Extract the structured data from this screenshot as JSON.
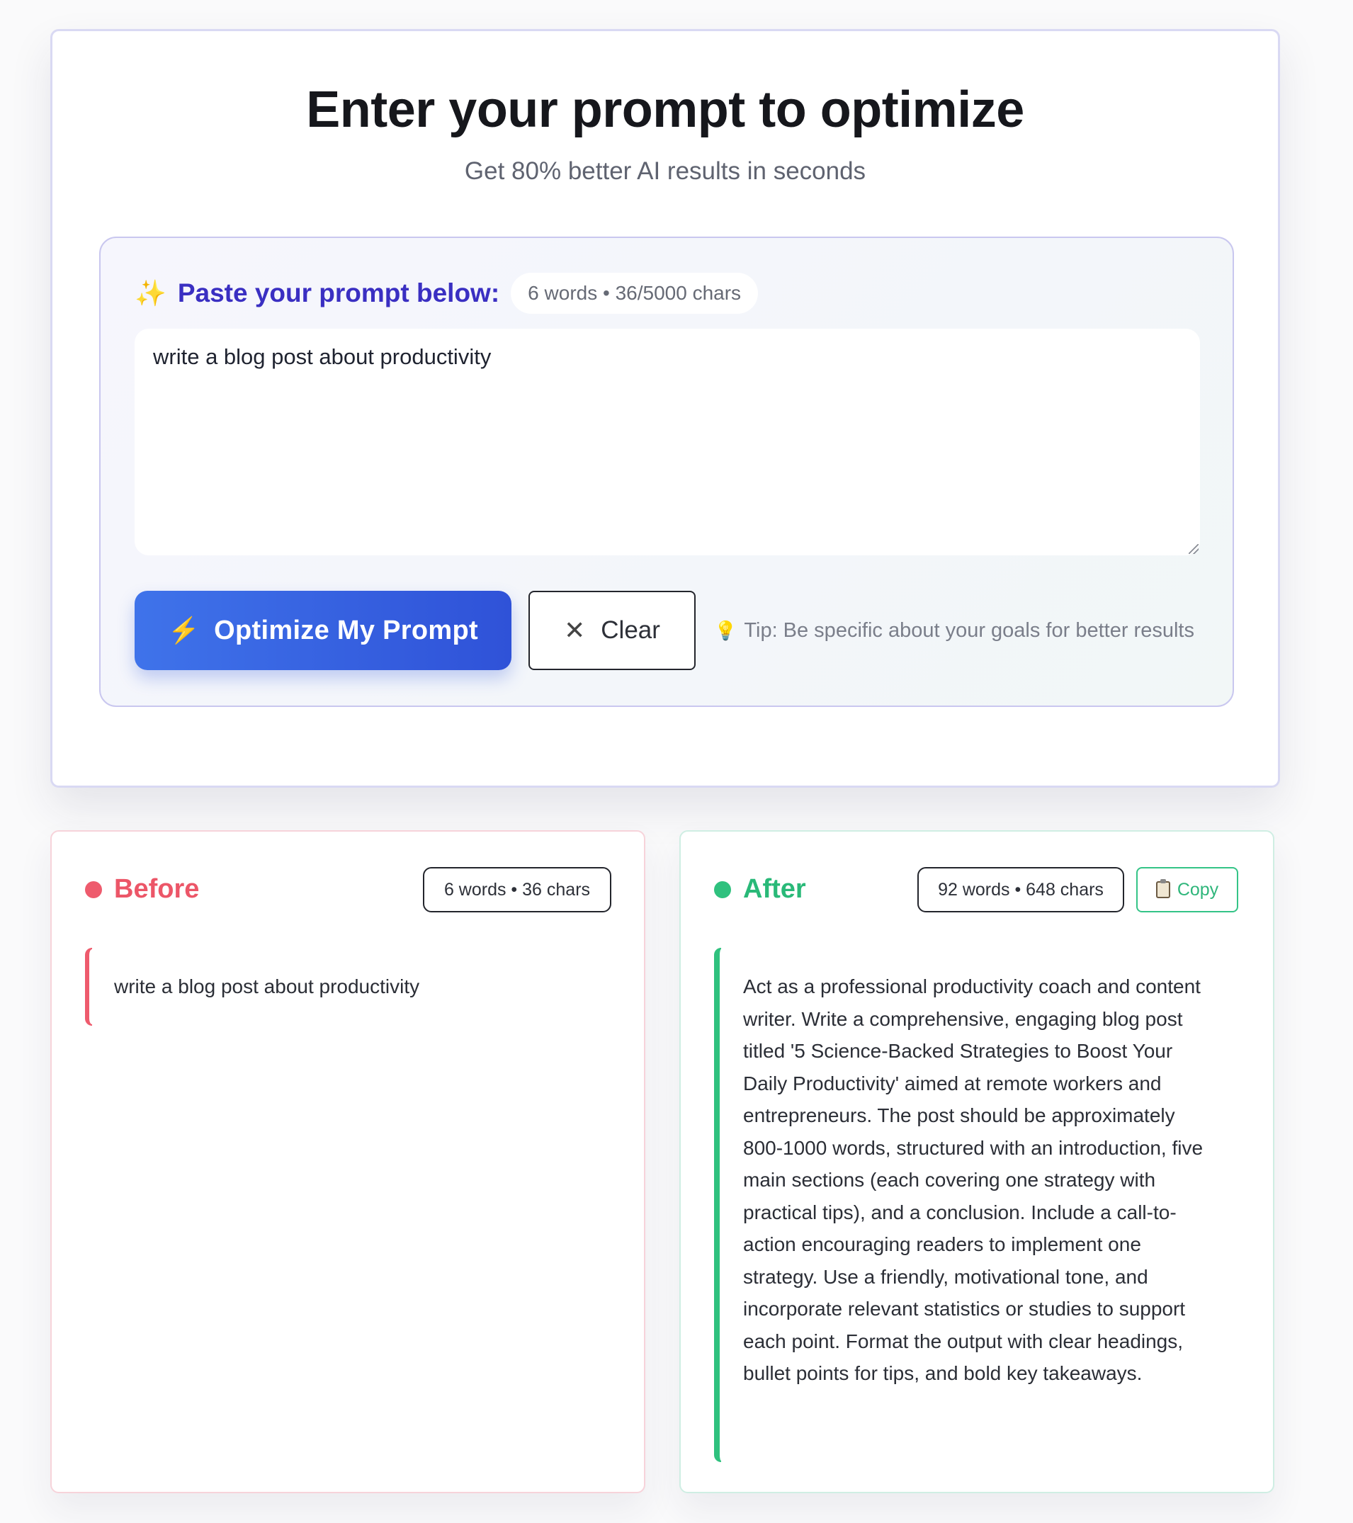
{
  "header": {
    "title": "Enter your prompt to optimize",
    "subtitle": "Get 80% better AI results in seconds"
  },
  "input": {
    "icon": "sparkles-icon",
    "label": "Paste your prompt below:",
    "stats": "6 words • 36/5000 chars",
    "value": "write a blog post about productivity",
    "optimize_label": "Optimize My Prompt",
    "clear_label": "Clear",
    "tip_label": "Tip:",
    "tip_text": "Be specific about your goals for better results"
  },
  "before": {
    "title": "Before",
    "stats": "6 words • 36 chars",
    "text": "write a blog post about productivity"
  },
  "after": {
    "title": "After",
    "stats": "92 words • 648 chars",
    "copy_label": "Copy",
    "text": "Act as a professional productivity coach and con­tent writer. Write a comprehensive, engaging blog post titled '5 Science-Backed Strategies to Boost Your Daily Productivity' aimed at remote workers and entrepreneurs. The post should be approxi­mately 800-1000 words, structured with an intro­duction, five main sections (each covering one strategy with practical tips), and a conclusion. Include a call-to-action encouraging readers to im­plement one strategy. Use a friendly, motivational tone, and incorporate relevant statistics or studies to support each point. Format the output with clear headings, bullet points for tips, and bold key takeaways."
  },
  "colors": {
    "accent": "#3a2fc2",
    "button": "#3f73ea",
    "before": "#ee5b6d",
    "after": "#2fc17e"
  }
}
